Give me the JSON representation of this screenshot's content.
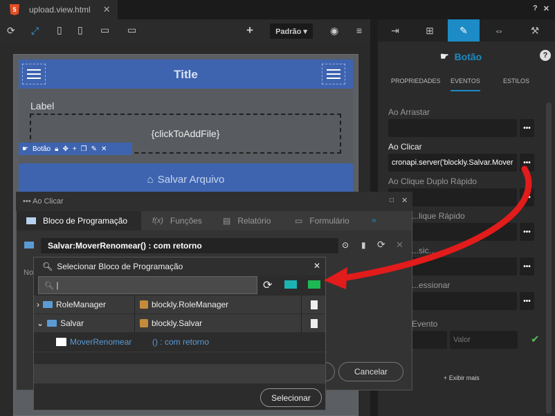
{
  "file_tab": {
    "badge": "5",
    "name": "upload.view.html",
    "close": "✕"
  },
  "toolbar": {
    "device_select": "Padrão ▾"
  },
  "canvas": {
    "app_title": "Title",
    "label": "Label",
    "dropzone": "{clickToAddFile}",
    "selected_component": "Botão",
    "button": "Salvar Arquivo"
  },
  "right_panel": {
    "component_title": "Botão",
    "help": "?",
    "tabs": [
      "PROPRIEDADES",
      "EVENTOS",
      "ESTILOS"
    ],
    "events": [
      {
        "label": "Ao Arrastar",
        "value": ""
      },
      {
        "label": "Ao Clicar",
        "value": "cronapi.server('blockly.Salvar.Mover"
      },
      {
        "label": "Ao Clique Duplo Rápido",
        "value": ""
      },
      {
        "label": "...lique Rápido",
        "value": ""
      },
      {
        "label": "...sic...",
        "value": ""
      },
      {
        "label": "...essionar",
        "value": ""
      }
    ],
    "new_event_label": "Evento",
    "value_placeholder": "Valor",
    "show_more": "+ Exibir mais",
    "dots": "•••"
  },
  "dialog": {
    "title": "••• Ao Clicar",
    "tabs": [
      "Bloco de Programação",
      "Funções",
      "Relatório",
      "Formulário"
    ],
    "more_tabs": "»",
    "block_value": "Salvar:MoverRenomear() : com retorno",
    "partial_label": "No",
    "cancel": "Cancelar"
  },
  "selector": {
    "title": "Selecionar Bloco de Programação",
    "close": "✕",
    "search_value": "|",
    "rows": [
      {
        "toggle": "›",
        "name": "RoleManager",
        "package": "blockly.RoleManager"
      },
      {
        "toggle": "⌄",
        "name": "Salvar",
        "package": "blockly.Salvar"
      }
    ],
    "function_row": {
      "name": "MoverRenomear",
      "signature": "() : com retorno"
    },
    "select_button": "Selecionar"
  }
}
